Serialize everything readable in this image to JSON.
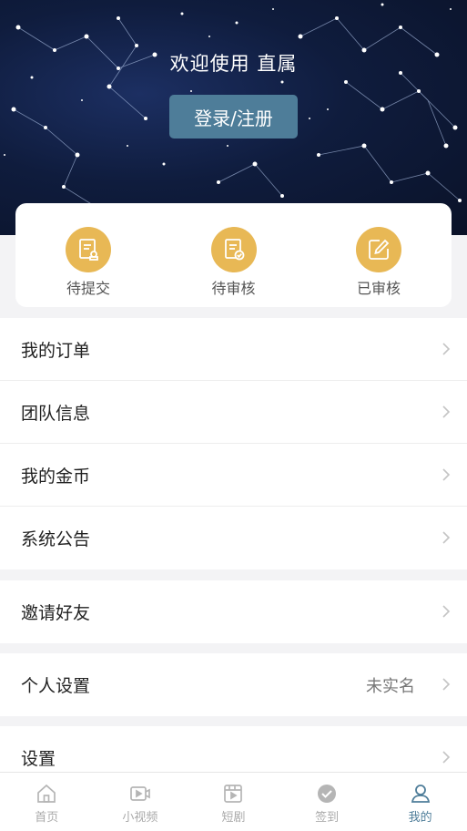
{
  "hero": {
    "welcome_text": "欢迎使用 直属",
    "login_label": "登录/注册"
  },
  "status": {
    "items": [
      {
        "label": "待提交",
        "icon": "document-stamp-icon"
      },
      {
        "label": "待审核",
        "icon": "document-check-icon"
      },
      {
        "label": "已审核",
        "icon": "edit-icon"
      }
    ],
    "icon_color": "#e8b855"
  },
  "menu": {
    "group1": [
      {
        "label": "我的订单"
      },
      {
        "label": "团队信息"
      },
      {
        "label": "我的金币"
      },
      {
        "label": "系统公告"
      }
    ],
    "group2": [
      {
        "label": "邀请好友"
      }
    ],
    "group3": [
      {
        "label": "个人设置",
        "value": "未实名"
      }
    ],
    "group4": [
      {
        "label": "设置"
      }
    ]
  },
  "tabbar": {
    "items": [
      {
        "label": "首页",
        "icon": "home-icon"
      },
      {
        "label": "小视频",
        "icon": "video-icon"
      },
      {
        "label": "短剧",
        "icon": "film-icon"
      },
      {
        "label": "签到",
        "icon": "check-circle-icon"
      },
      {
        "label": "我的",
        "icon": "user-icon",
        "active": true
      }
    ],
    "active_color": "#4e7d99"
  }
}
